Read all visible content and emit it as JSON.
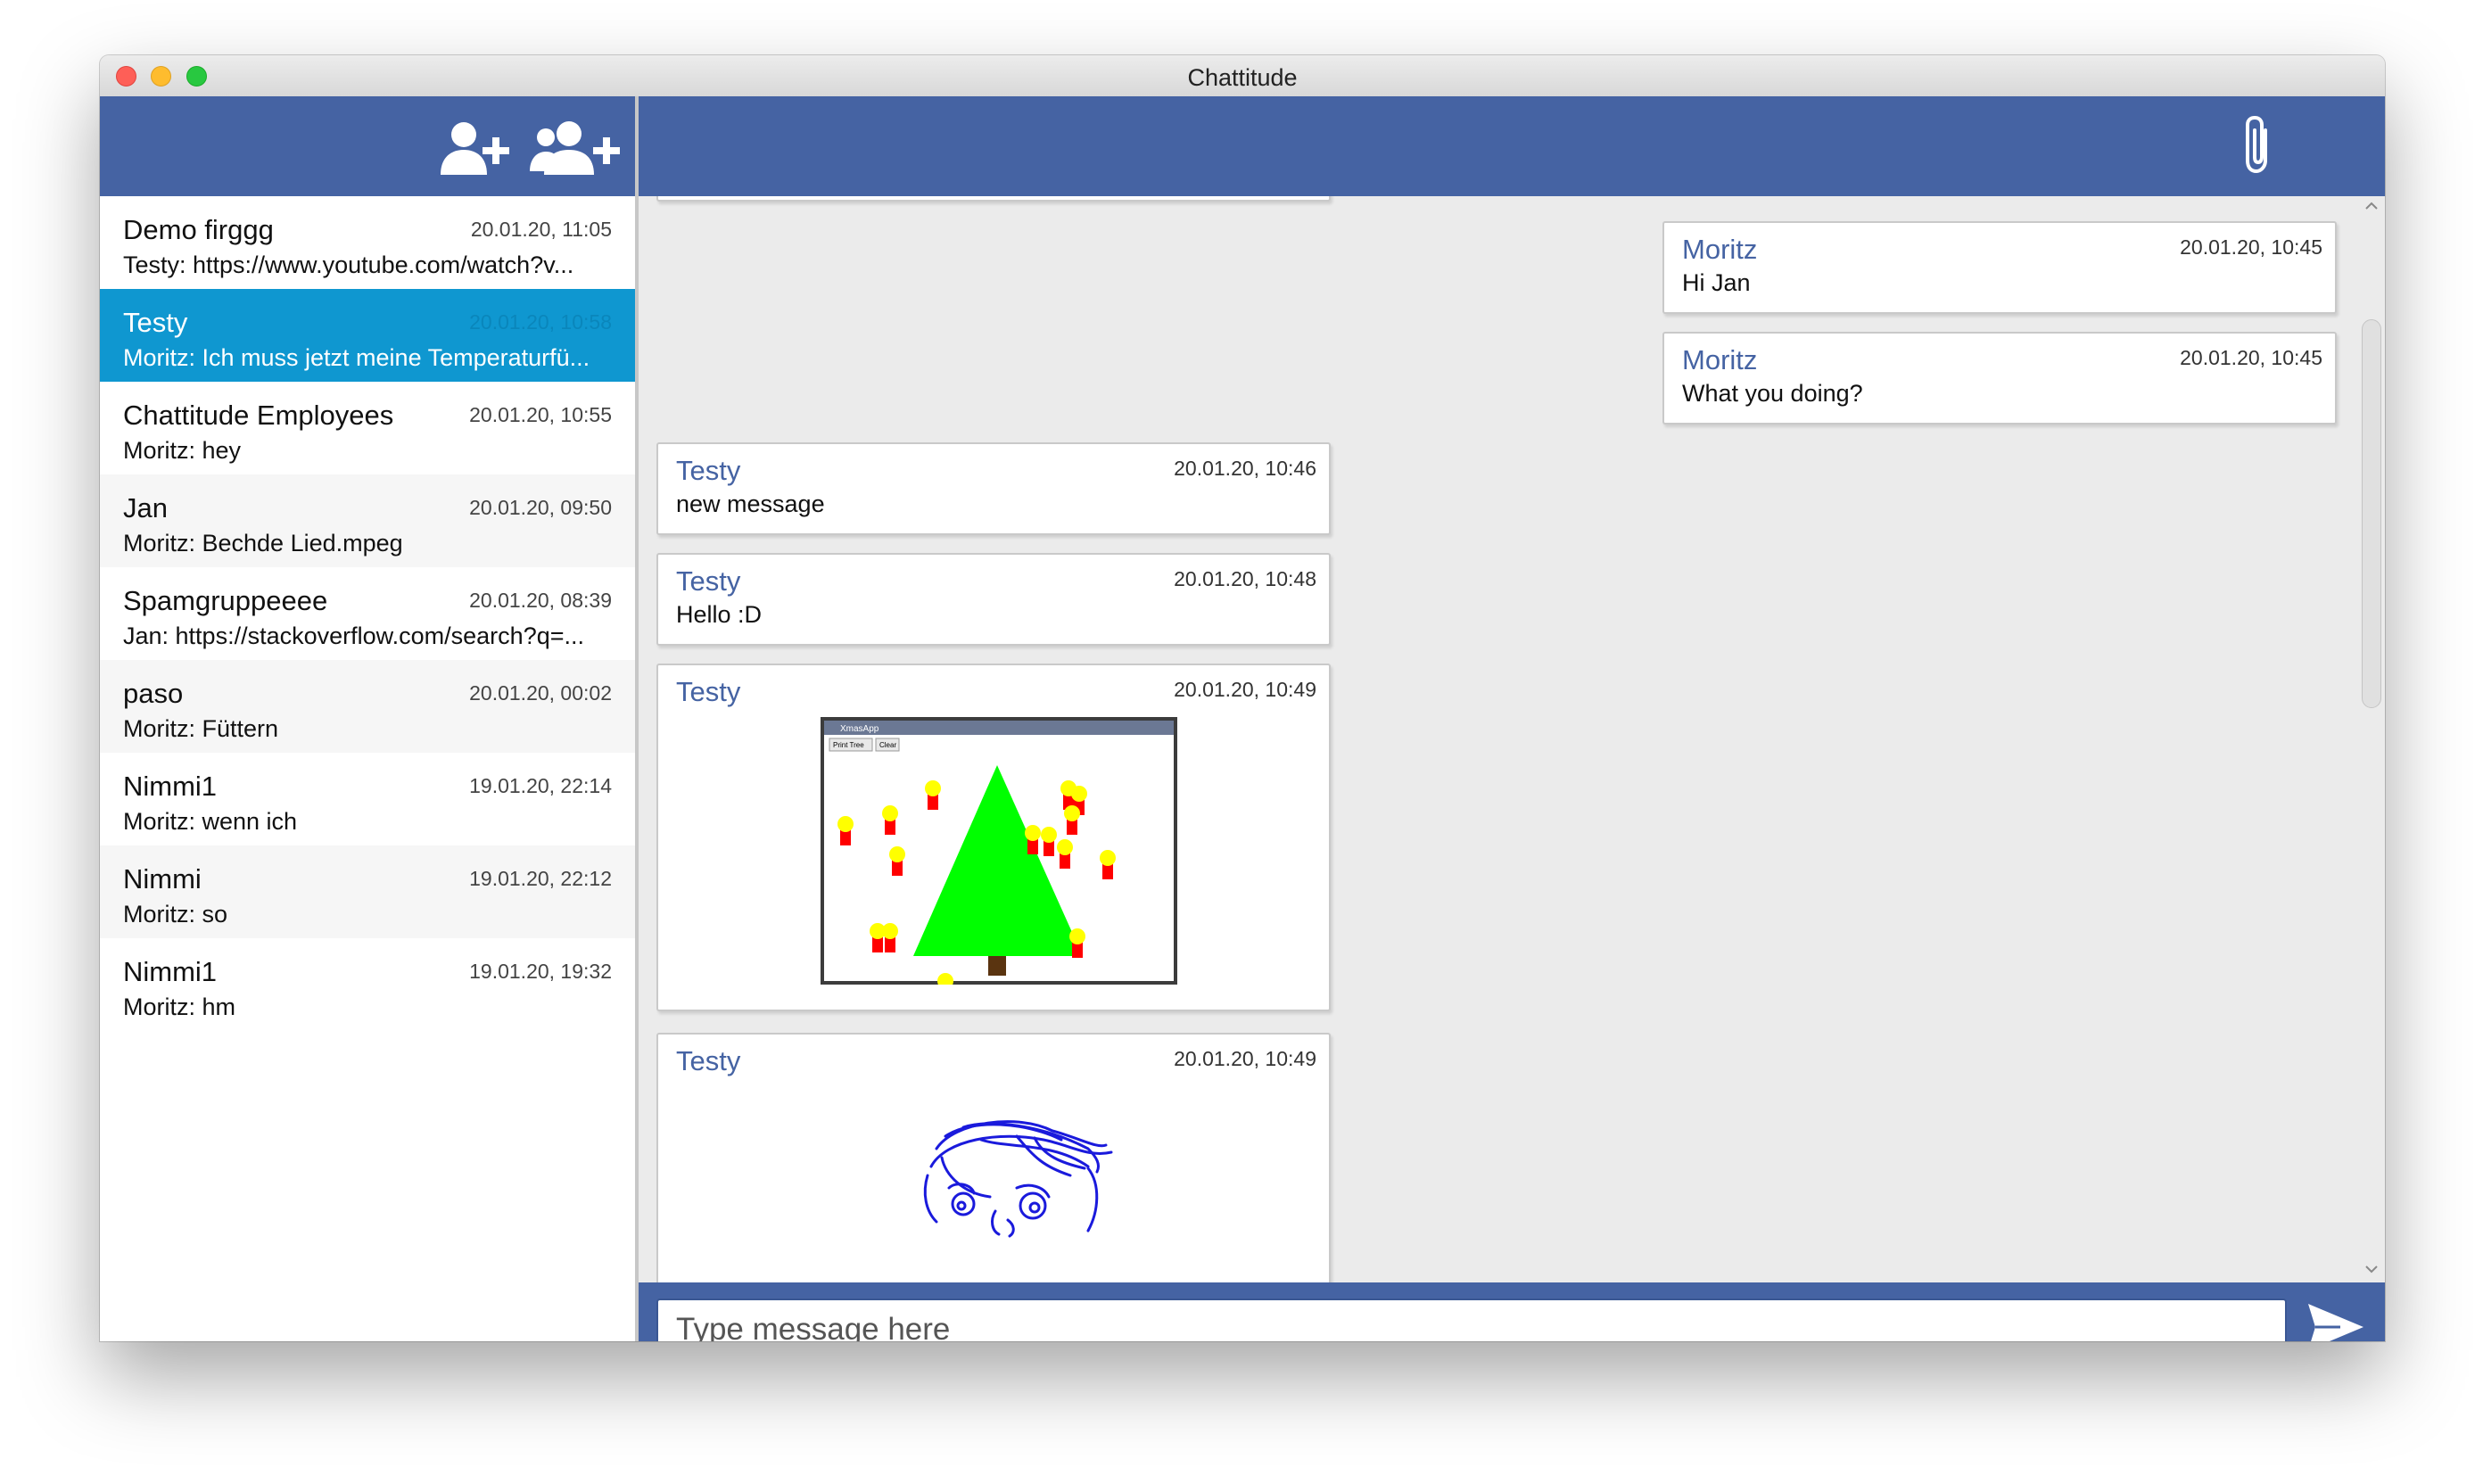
{
  "window": {
    "title": "Chattitude"
  },
  "left_header": {
    "add_contact_icon": "add-contact-icon",
    "add_group_icon": "add-group-icon"
  },
  "chats": [
    {
      "name": "Demo firggg",
      "time": "20.01.20, 11:05",
      "preview": "Testy: https://www.youtube.com/watch?v..."
    },
    {
      "name": "Testy",
      "time": "20.01.20, 10:58",
      "preview": "Moritz: Ich muss jetzt meine Temperaturfü...",
      "selected": true
    },
    {
      "name": "Chattitude Employees",
      "time": "20.01.20, 10:55",
      "preview": "Moritz: hey"
    },
    {
      "name": "Jan",
      "time": "20.01.20, 09:50",
      "preview": "Moritz: Bechde Lied.mpeg"
    },
    {
      "name": "Spamgruppeeee",
      "time": "20.01.20, 08:39",
      "preview": "Jan: https://stackoverflow.com/search?q=..."
    },
    {
      "name": "paso",
      "time": "20.01.20, 00:02",
      "preview": "Moritz: Füttern"
    },
    {
      "name": "Nimmi1",
      "time": "19.01.20, 22:14",
      "preview": "Moritz: wenn ich"
    },
    {
      "name": "Nimmi",
      "time": "19.01.20, 22:12",
      "preview": "Moritz: so"
    },
    {
      "name": "Nimmi1",
      "time": "19.01.20, 19:32",
      "preview": "Moritz: hm"
    }
  ],
  "right_header": {
    "attach_icon": "paperclip-icon"
  },
  "messages": [
    {
      "sender": "Moritz",
      "time": "20.01.20, 10:45",
      "text": "Hi Jan",
      "side": "right"
    },
    {
      "sender": "Moritz",
      "time": "20.01.20, 10:45",
      "text": "What you doing?",
      "side": "right"
    },
    {
      "sender": "Testy",
      "time": "20.01.20, 10:46",
      "text": "new message",
      "side": "left"
    },
    {
      "sender": "Testy",
      "time": "20.01.20, 10:48",
      "text": "Hello :D",
      "side": "left"
    },
    {
      "sender": "Testy",
      "time": "20.01.20, 10:49",
      "text": "",
      "side": "left",
      "image": "christmas-tree-drawing",
      "image_title": "XmasApp",
      "image_buttons": [
        "Print Tree",
        "Clear"
      ]
    },
    {
      "sender": "Testy",
      "time": "20.01.20, 10:49",
      "text": "",
      "side": "left",
      "image": "face-sketch"
    }
  ],
  "composer": {
    "placeholder": "Type message here",
    "value": "",
    "send_icon": "send-icon"
  },
  "colors": {
    "header_blue": "#4563a3",
    "selected_blue": "#0f97d0",
    "sender_blue": "#4563a3",
    "chat_bg": "#ebebeb"
  }
}
